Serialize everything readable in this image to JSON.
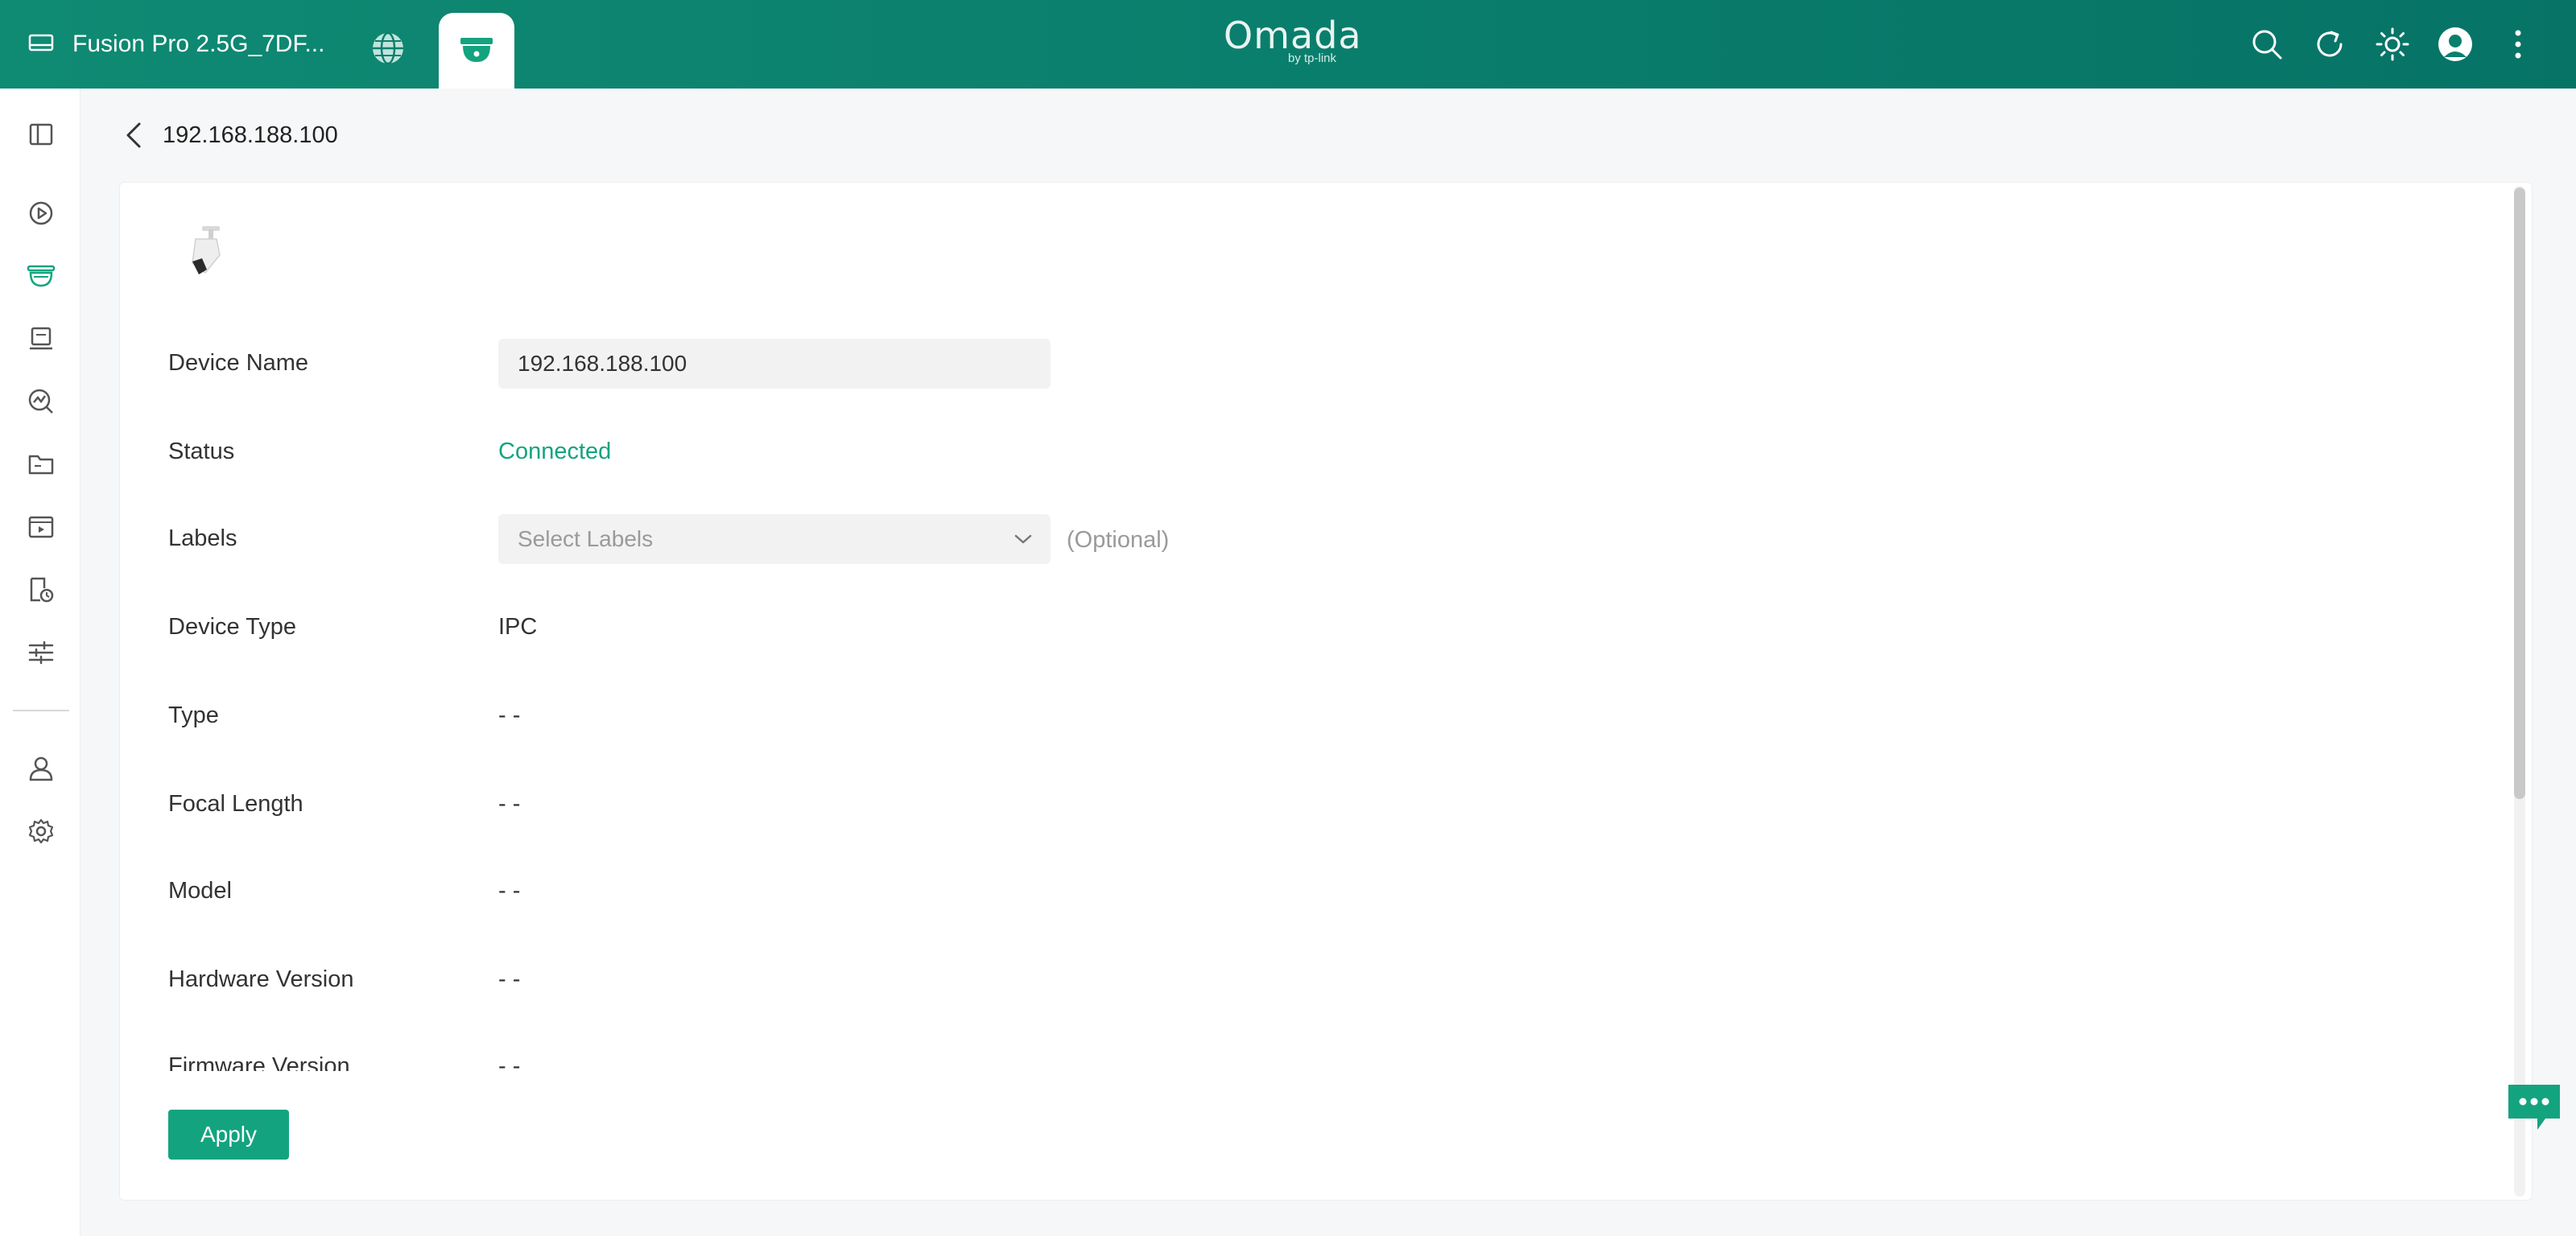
{
  "header": {
    "device_name": "Fusion Pro 2.5G_7DF...",
    "logo_text": "Omada",
    "logo_byline": "by tp-link",
    "icons": [
      "server-icon",
      "globe-icon",
      "camera-tab-icon",
      "search-icon",
      "refresh-icon",
      "theme-sun-icon",
      "avatar",
      "more-vertical-icon"
    ],
    "accent_color": "#0b7f6d"
  },
  "sidebar": {
    "items": [
      "collapse-sidebar-icon",
      "playback-icon",
      "surveillance-icon",
      "devices-icon",
      "analytics-icon",
      "files-icon",
      "media-icon",
      "logs-icon",
      "adjust-icon",
      "account-icon",
      "settings-icon"
    ],
    "active": "surveillance-icon"
  },
  "breadcrumb": {
    "title": "192.168.188.100"
  },
  "form": {
    "device_name_label": "Device Name",
    "device_name_value": "192.168.188.100",
    "status_label": "Status",
    "status_value": "Connected",
    "labels_label": "Labels",
    "labels_placeholder": "Select Labels",
    "labels_hint": "(Optional)",
    "device_type_label": "Device Type",
    "device_type_value": "IPC",
    "type_label": "Type",
    "type_value": "- -",
    "focal_length_label": "Focal Length",
    "focal_length_value": "- -",
    "model_label": "Model",
    "model_value": "- -",
    "hardware_version_label": "Hardware Version",
    "hardware_version_value": "- -",
    "firmware_version_label": "Firmware Version",
    "firmware_version_value": "- -"
  },
  "actions": {
    "apply_label": "Apply"
  },
  "colors": {
    "primary": "#14a37f",
    "status_ok": "#14a37f"
  }
}
